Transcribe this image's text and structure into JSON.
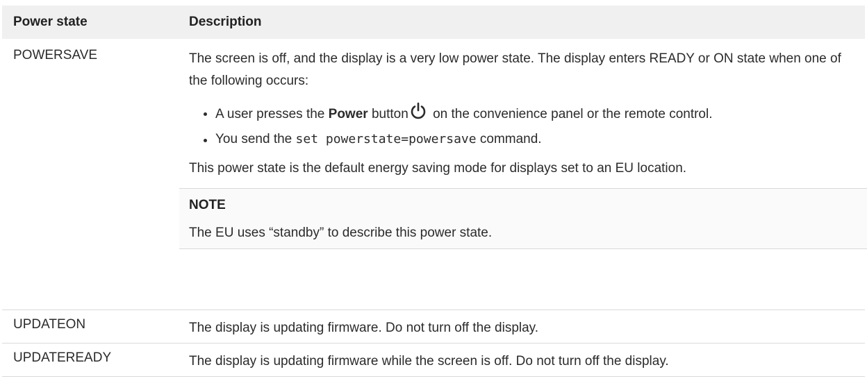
{
  "table": {
    "header": {
      "col1": "Power state",
      "col2": "Description"
    },
    "rows": [
      {
        "state": "POWERSAVE",
        "intro": "The screen is off, and the display is a very low power state. The display enters READY or ON state when one of the following occurs:",
        "bullets": {
          "b1_pre": "A user presses the ",
          "b1_bold": "Power",
          "b1_mid": " button",
          "b1_icon": "power-icon",
          "b1_post": " on the convenience panel or the remote control.",
          "b2_pre": "You send the ",
          "b2_code": "set powerstate=powersave",
          "b2_post": " command."
        },
        "after": "This power state is the default energy saving mode for displays set to an EU location.",
        "note": {
          "title": "NOTE",
          "body": "The EU uses “standby” to describe this power state."
        }
      },
      {
        "state": "UPDATEON",
        "description": "The display is updating firmware. Do not turn off the display."
      },
      {
        "state": "UPDATEREADY",
        "description": "The display is updating firmware while the screen is off. Do not turn off the display."
      }
    ]
  }
}
